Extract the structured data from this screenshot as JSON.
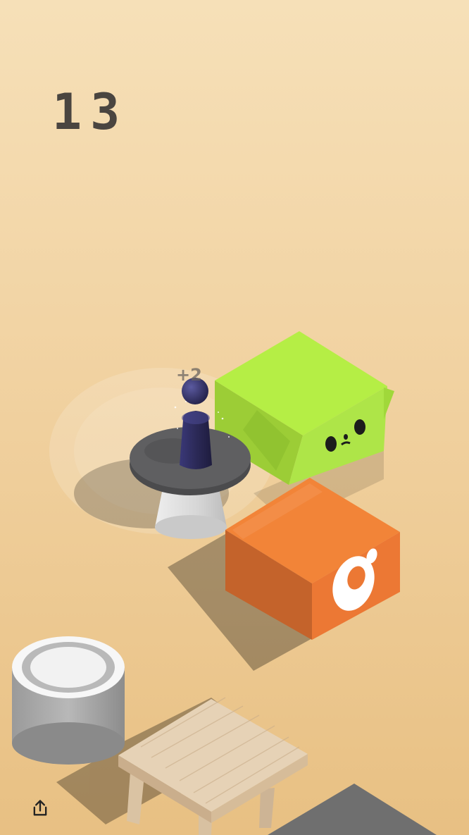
{
  "hud": {
    "score": "13",
    "bonus_popup": "+2"
  },
  "icons": {
    "share": "share-icon"
  },
  "colors": {
    "background_top": "#f6e0b8",
    "background_bottom": "#e8c083",
    "score_text": "#4a4540",
    "green_box": "#b5ee45",
    "orange_box": "#f28438",
    "gray_platform": "#5f5f61",
    "player": "#2c2a58",
    "wood_stool": "#e6d2b6"
  }
}
